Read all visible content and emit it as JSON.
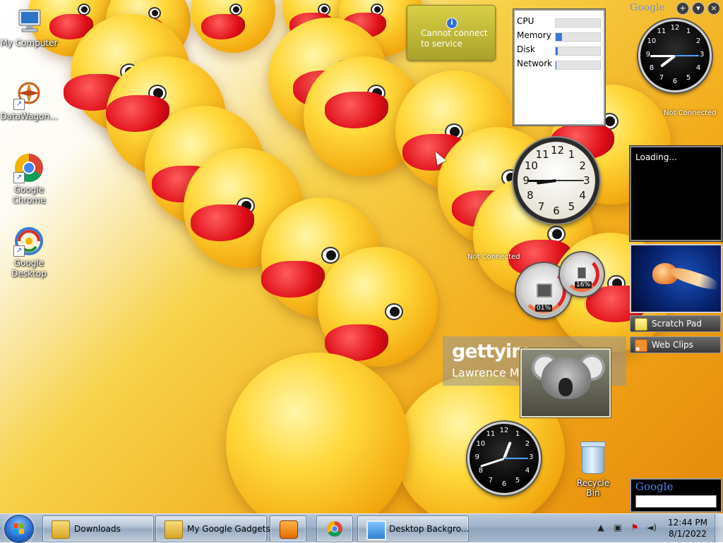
{
  "desktop_icons": [
    {
      "label": "My Computer",
      "icon": "computer-icon"
    },
    {
      "label": "DataWagon...",
      "icon": "datawagon-icon"
    },
    {
      "label": "Google Chrome",
      "icon": "chrome-icon"
    },
    {
      "label": "Google Desktop",
      "icon": "google-desktop-icon"
    }
  ],
  "gadgets": {
    "weather": {
      "message": "Cannot connect to service",
      "info_glyph": "i"
    },
    "meter": {
      "rows": [
        {
          "label": "CPU",
          "level": 0.0
        },
        {
          "label": "Memory",
          "level": 0.15
        },
        {
          "label": "Disk",
          "level": 0.05
        },
        {
          "label": "Network",
          "level": 0.02
        }
      ]
    },
    "clock_top_status": "Not Connected",
    "clock_mid_status": "Not Connected",
    "cpu_dial": {
      "value": "01%"
    },
    "mem_dial": {
      "value": "16%"
    },
    "slideshow": {
      "status": "Loading..."
    },
    "scratch_pad": {
      "label": "Scratch Pad"
    },
    "web_clips": {
      "label": "Web Clips"
    },
    "getty": {
      "brand": "gettyim",
      "credit": "Lawrence Ma"
    },
    "google_search": {
      "logo": "Google",
      "query": ""
    },
    "sidebar_logo": "Google"
  },
  "clock_numbers": [
    "12",
    "1",
    "2",
    "3",
    "4",
    "5",
    "6",
    "7",
    "8",
    "9",
    "10",
    "11"
  ],
  "recycle_bin": {
    "label": "Recycle Bin"
  },
  "taskbar": {
    "items": [
      {
        "label": "Downloads"
      },
      {
        "label": "My Google Gadgets"
      },
      {
        "label": ""
      },
      {
        "label": ""
      },
      {
        "label": "Desktop Backgro..."
      }
    ],
    "time": "12:44 PM",
    "date": "8/1/2022"
  },
  "colors": {
    "taskbar": "#9fb2c9",
    "duck_yellow": "#ffd83a",
    "duck_beak": "#e0101a",
    "meter_fill": "#3a78d8"
  }
}
